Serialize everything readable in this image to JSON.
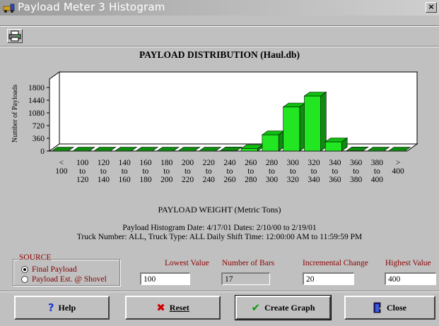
{
  "window": {
    "title": "Payload Meter 3 Histogram",
    "close_label": "×"
  },
  "chart_data": {
    "type": "bar",
    "title": "PAYLOAD DISTRIBUTION (Haul.db)",
    "ylabel": "Number of Payloads",
    "xlabel": "PAYLOAD WEIGHT (Metric Tons)",
    "ylim": [
      0,
      1800
    ],
    "yticks": [
      "1800",
      "1440",
      "1080",
      "720",
      "360",
      "0"
    ],
    "ytick_values": [
      1800,
      1440,
      1080,
      720,
      360,
      0
    ],
    "categories": [
      [
        "<",
        "100",
        ""
      ],
      [
        "100",
        "to",
        "120"
      ],
      [
        "120",
        "to",
        "140"
      ],
      [
        "140",
        "to",
        "160"
      ],
      [
        "160",
        "to",
        "180"
      ],
      [
        "180",
        "to",
        "200"
      ],
      [
        "200",
        "to",
        "220"
      ],
      [
        "220",
        "to",
        "240"
      ],
      [
        "240",
        "to",
        "260"
      ],
      [
        "260",
        "to",
        "280"
      ],
      [
        "280",
        "to",
        "300"
      ],
      [
        "300",
        "to",
        "320"
      ],
      [
        "320",
        "to",
        "340"
      ],
      [
        "340",
        "to",
        "360"
      ],
      [
        "360",
        "to",
        "380"
      ],
      [
        "380",
        "to",
        "400"
      ],
      [
        ">",
        "400",
        ""
      ]
    ],
    "values": [
      0,
      0,
      0,
      0,
      0,
      0,
      0,
      0,
      5,
      70,
      460,
      1250,
      1560,
      260,
      5,
      0,
      0
    ],
    "bar_color": "#22e622",
    "bar_side_color": "#108a10",
    "bar_top_color": "#0fbf0f",
    "grid": false,
    "style": "3d"
  },
  "info": {
    "line1": "Payload Histogram Date: 4/17/01    Dates: 2/10/00  to  2/19/01",
    "line2": "Truck Number: ALL, Truck Type: ALL    Daily Shift Time: 12:00:00 AM to 11:59:59 PM"
  },
  "source": {
    "legend": "SOURCE",
    "options": [
      {
        "label": "Final Payload",
        "selected": true
      },
      {
        "label": "Payload Est. @ Shovel",
        "selected": false
      }
    ]
  },
  "fields": {
    "lowest": {
      "label": "Lowest Value",
      "value": "100"
    },
    "bars": {
      "label": "Number of Bars",
      "value": "17"
    },
    "increment": {
      "label": "Incremental Change",
      "value": "20"
    },
    "highest": {
      "label": "Highest Value",
      "value": "400"
    }
  },
  "buttons": {
    "help": {
      "label": "Help",
      "icon": "question-icon"
    },
    "reset": {
      "label": "Reset",
      "icon": "x-icon"
    },
    "create": {
      "label": "Create Graph",
      "icon": "checkmark-icon"
    },
    "close": {
      "label": "Close",
      "icon": "door-icon"
    }
  },
  "colors": {
    "label_red": "#8b0000",
    "window_bg": "#c0c0c0"
  }
}
